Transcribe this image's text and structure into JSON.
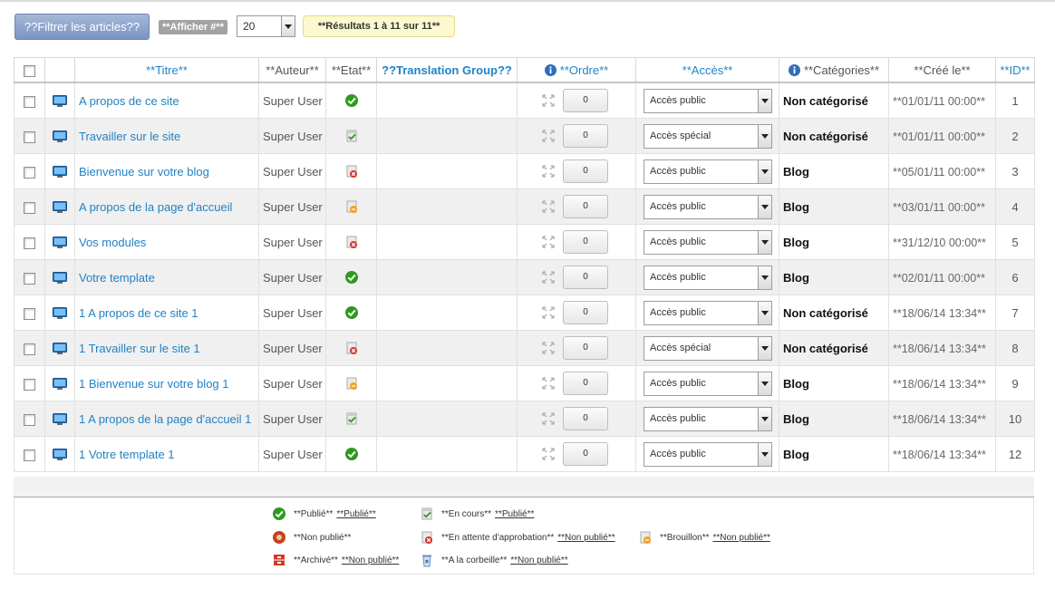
{
  "toolbar": {
    "filter_label": "??Filtrer les articles??",
    "display_label": "**Afficher #**",
    "limit_value": "20",
    "results_text": "**Résultats 1 à 11 sur 11**"
  },
  "headers": {
    "title": "**Titre**",
    "author": "**Auteur**",
    "state": "**Etat**",
    "translation_group": "??Translation Group??",
    "order": "**Ordre**",
    "access": "**Accès**",
    "categories": "**Catégories**",
    "created": "**Créé le**",
    "id": "**ID**"
  },
  "rows": [
    {
      "title": "A propos de ce site",
      "author": "Super User",
      "state": "published",
      "order": "0",
      "access": "Accès public",
      "category": "Non catégorisé",
      "created": "**01/01/11 00:00**",
      "id": "1"
    },
    {
      "title": "Travailler sur le site",
      "author": "Super User",
      "state": "current",
      "order": "0",
      "access": "Accès spécial",
      "category": "Non catégorisé",
      "created": "**01/01/11 00:00**",
      "id": "2"
    },
    {
      "title": "Bienvenue sur votre blog",
      "author": "Super User",
      "state": "pending",
      "order": "0",
      "access": "Accès public",
      "category": "Blog",
      "created": "**05/01/11 00:00**",
      "id": "3"
    },
    {
      "title": "A propos de la page d'accueil",
      "author": "Super User",
      "state": "draft",
      "order": "0",
      "access": "Accès public",
      "category": "Blog",
      "created": "**03/01/11 00:00**",
      "id": "4"
    },
    {
      "title": "Vos modules",
      "author": "Super User",
      "state": "pending",
      "order": "0",
      "access": "Accès public",
      "category": "Blog",
      "created": "**31/12/10 00:00**",
      "id": "5"
    },
    {
      "title": "Votre template",
      "author": "Super User",
      "state": "published",
      "order": "0",
      "access": "Accès public",
      "category": "Blog",
      "created": "**02/01/11 00:00**",
      "id": "6"
    },
    {
      "title": "1 A propos de ce site 1",
      "author": "Super User",
      "state": "published",
      "order": "0",
      "access": "Accès public",
      "category": "Non catégorisé",
      "created": "**18/06/14 13:34**",
      "id": "7"
    },
    {
      "title": "1 Travailler sur le site 1",
      "author": "Super User",
      "state": "pending",
      "order": "0",
      "access": "Accès spécial",
      "category": "Non catégorisé",
      "created": "**18/06/14 13:34**",
      "id": "8"
    },
    {
      "title": "1 Bienvenue sur votre blog 1",
      "author": "Super User",
      "state": "draft",
      "order": "0",
      "access": "Accès public",
      "category": "Blog",
      "created": "**18/06/14 13:34**",
      "id": "9"
    },
    {
      "title": "1 A propos de la page d'accueil 1",
      "author": "Super User",
      "state": "current",
      "order": "0",
      "access": "Accès public",
      "category": "Blog",
      "created": "**18/06/14 13:34**",
      "id": "10"
    },
    {
      "title": "1 Votre template 1",
      "author": "Super User",
      "state": "published",
      "order": "0",
      "access": "Accès public",
      "category": "Blog",
      "created": "**18/06/14 13:34**",
      "id": "12"
    }
  ],
  "legend": {
    "published": {
      "label": "**Publié**",
      "link": "**Publié**"
    },
    "current": {
      "label": "**En cours**",
      "link": "**Publié**"
    },
    "unpublished": {
      "label": "**Non publié**"
    },
    "pending": {
      "label": "**En attente d'approbation**",
      "link": "**Non publié**"
    },
    "draft": {
      "label": "**Brouillon**",
      "link": "**Non publié**"
    },
    "archived": {
      "label": "**Archivé**",
      "link": "**Non publié**"
    },
    "trashed": {
      "label": "**A la corbeille**",
      "link": "**Non publié**"
    }
  },
  "colors": {
    "link": "#1f84c7",
    "accent_button": "#7b95c2",
    "results_bg": "#fcf9cf",
    "published_green": "#2e9a1f",
    "pending_red": "#d9302c",
    "draft_orange": "#f3a21c"
  }
}
